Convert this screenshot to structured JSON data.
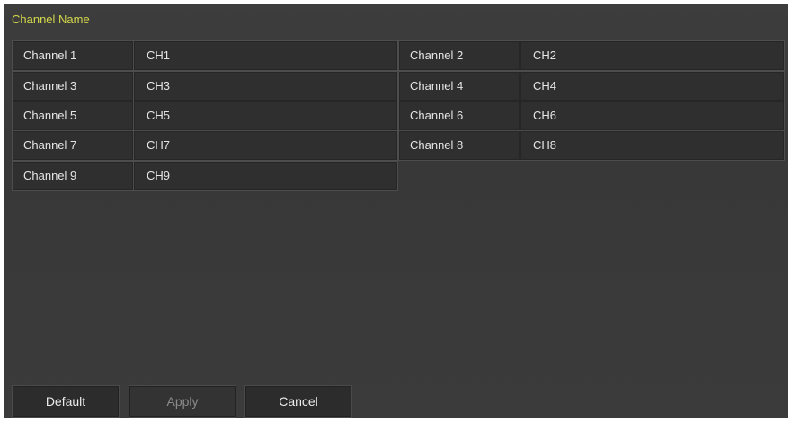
{
  "title": "Channel Name",
  "channels": [
    {
      "label": "Channel 1",
      "value": "CH1"
    },
    {
      "label": "Channel 2",
      "value": "CH2"
    },
    {
      "label": "Channel 3",
      "value": "CH3"
    },
    {
      "label": "Channel 4",
      "value": "CH4"
    },
    {
      "label": "Channel 5",
      "value": "CH5"
    },
    {
      "label": "Channel 6",
      "value": "CH6"
    },
    {
      "label": "Channel 7",
      "value": "CH7"
    },
    {
      "label": "Channel 8",
      "value": "CH8"
    },
    {
      "label": "Channel 9",
      "value": "CH9"
    }
  ],
  "buttons": {
    "default_label": "Default",
    "apply_label": "Apply",
    "cancel_label": "Cancel"
  },
  "colors": {
    "title": "#d4d84a",
    "panel_bg": "#3a3a3a",
    "cell_bg": "#2f2f2f"
  }
}
